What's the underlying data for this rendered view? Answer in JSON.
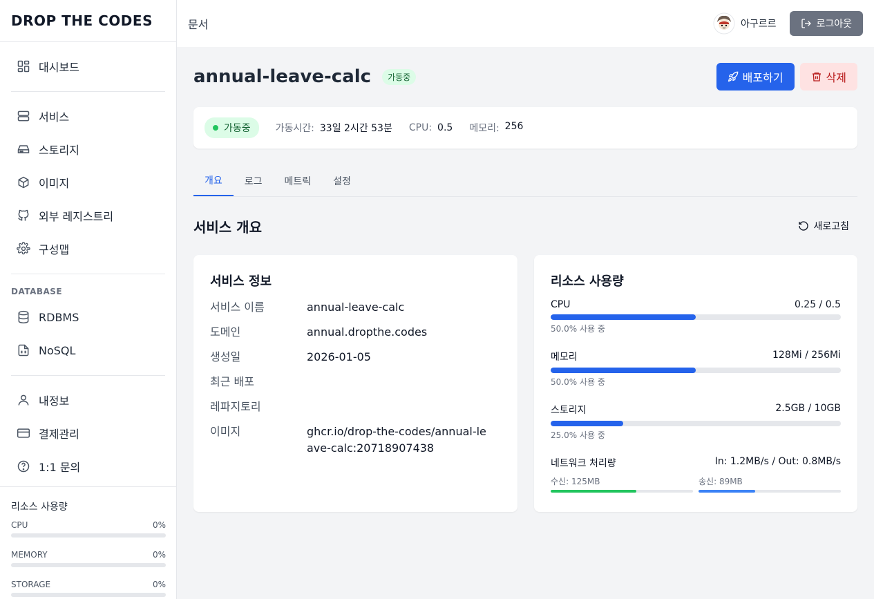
{
  "brand": "DROP THE CODES",
  "sidebar": {
    "group1": [
      {
        "label": "대시보드",
        "icon": "dashboard-icon"
      }
    ],
    "group2": [
      {
        "label": "서비스",
        "icon": "server-icon"
      },
      {
        "label": "스토리지",
        "icon": "drive-icon"
      },
      {
        "label": "이미지",
        "icon": "package-icon"
      },
      {
        "label": "외부 레지스트리",
        "icon": "github-icon"
      },
      {
        "label": "구성맵",
        "icon": "gear-icon"
      }
    ],
    "database_label": "DATABASE",
    "group3": [
      {
        "label": "RDBMS",
        "icon": "database-icon"
      },
      {
        "label": "NoSQL",
        "icon": "file-code-icon"
      }
    ],
    "group4": [
      {
        "label": "내정보",
        "icon": "user-icon"
      },
      {
        "label": "결제관리",
        "icon": "credit-card-icon"
      },
      {
        "label": "1:1 문의",
        "icon": "help-icon"
      }
    ],
    "usage": {
      "title": "리소스 사용량",
      "items": [
        {
          "label": "CPU",
          "value": "0%"
        },
        {
          "label": "MEMORY",
          "value": "0%"
        },
        {
          "label": "STORAGE",
          "value": "0%"
        }
      ]
    }
  },
  "topbar": {
    "docs_link": "문서",
    "username": "아구르르",
    "logout_label": "로그아웃"
  },
  "service": {
    "name": "annual-leave-calc",
    "status_badge": "가동중",
    "deploy_label": "배포하기",
    "delete_label": "삭제"
  },
  "status": {
    "state": "가동중",
    "uptime_label": "가동시간:",
    "uptime_value": "33일 2시간 53분",
    "cpu_label": "CPU:",
    "cpu_value": "0.5",
    "memory_label": "메모리:",
    "memory_value": "256"
  },
  "tabs": [
    "개요",
    "로그",
    "메트릭",
    "설정"
  ],
  "overview": {
    "title": "서비스 개요",
    "refresh_label": "새로고침"
  },
  "info_card": {
    "title": "서비스 정보",
    "rows": [
      {
        "k": "서비스 이름",
        "v": "annual-leave-calc"
      },
      {
        "k": "도메인",
        "v": "annual.dropthe.codes"
      },
      {
        "k": "생성일",
        "v": "2026-01-05"
      },
      {
        "k": "최근 배포",
        "v": ""
      },
      {
        "k": "레파지토리",
        "v": ""
      },
      {
        "k": "이미지",
        "v": "ghcr.io/drop-the-codes/annual-leave-calc:20718907438"
      }
    ]
  },
  "resource_card": {
    "title": "리소스 사용량",
    "items": [
      {
        "label": "CPU",
        "value": "0.25 / 0.5",
        "sub": "50.0% 사용 중",
        "pct": 50
      },
      {
        "label": "메모리",
        "value": "128Mi / 256Mi",
        "sub": "50.0% 사용 중",
        "pct": 50
      },
      {
        "label": "스토리지",
        "value": "2.5GB / 10GB",
        "sub": "25.0% 사용 중",
        "pct": 25
      }
    ],
    "network": {
      "label": "네트워크 처리량",
      "value": "In: 1.2MB/s / Out: 0.8MB/s",
      "rx_label": "수신: 125MB",
      "rx_pct": 60,
      "tx_label": "송신: 89MB",
      "tx_pct": 40
    }
  },
  "colors": {
    "primary": "#2563eb",
    "success": "#22c55e",
    "danger": "#b91c1c"
  }
}
